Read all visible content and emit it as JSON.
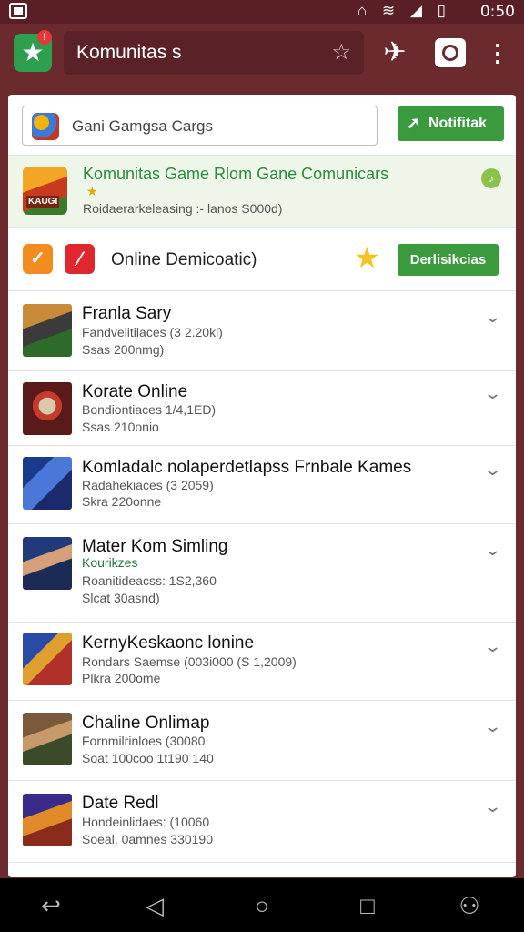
{
  "status_bar": {
    "time": "0:50",
    "icons": "⌂ ≋ ◢ ▯"
  },
  "app_bar": {
    "title": "Komunitas s",
    "badge": "!",
    "logo_icon": "star-icon",
    "menu_glyph": "⋮"
  },
  "search": {
    "value": "Gani Gamgsa Cargs",
    "icon": "game-collection-icon"
  },
  "notify_button": {
    "label": "Notifitak",
    "icon": "send-icon"
  },
  "featured": {
    "title": "Komunitas Game Rlom Gane Comunicars",
    "subtitle": "Roidaerarkeleasing :- lanos S000d)",
    "icon_label": "KAUGI",
    "indicator": "♪"
  },
  "filter": {
    "label": "Online Demicoatic)",
    "button_label": "Derlisikcias",
    "colors": {
      "orange": "#f28c1f",
      "red": "#e0262e",
      "star": "#f6c21d"
    }
  },
  "games": [
    {
      "title": "Franla Sary",
      "tag": "",
      "line1": "Fandvelitilaces (3 2.20kl)",
      "line2": "Ssas 200nmg)"
    },
    {
      "title": "Korate Online",
      "tag": "",
      "line1": "Bondiontiaces 1/4,1ED)",
      "line2": "Ssas 210onio"
    },
    {
      "title": "Komladalc nolaperdetlapss Frnbale Kames",
      "tag": "",
      "line1": "Radahekiaces (3 2059)",
      "line2": "Skra 220onne"
    },
    {
      "title": "Mater Kom Simling",
      "tag": "Kourikzes",
      "line1": "Roanitideacss: 1S2,360",
      "line2": "Slcat 30asnd)"
    },
    {
      "title": "KernyKeskaonc lonine",
      "tag": "",
      "line1": "Rondars Saemse (003i000 (S 1,2009)",
      "line2": "Plkra 200ome"
    },
    {
      "title": "Chaline Onlimap",
      "tag": "",
      "line1": "Fornmilrinloes (30080",
      "line2": "Soat 100coo 1t190 140"
    },
    {
      "title": "Date Redl",
      "tag": "",
      "line1": "Hondeinlidaes: (10060",
      "line2": "Soeal, 0amnes 330190"
    }
  ],
  "nav": {
    "back2": "↩",
    "back": "◁",
    "home": "○",
    "recent": "□",
    "user": "⚇"
  }
}
